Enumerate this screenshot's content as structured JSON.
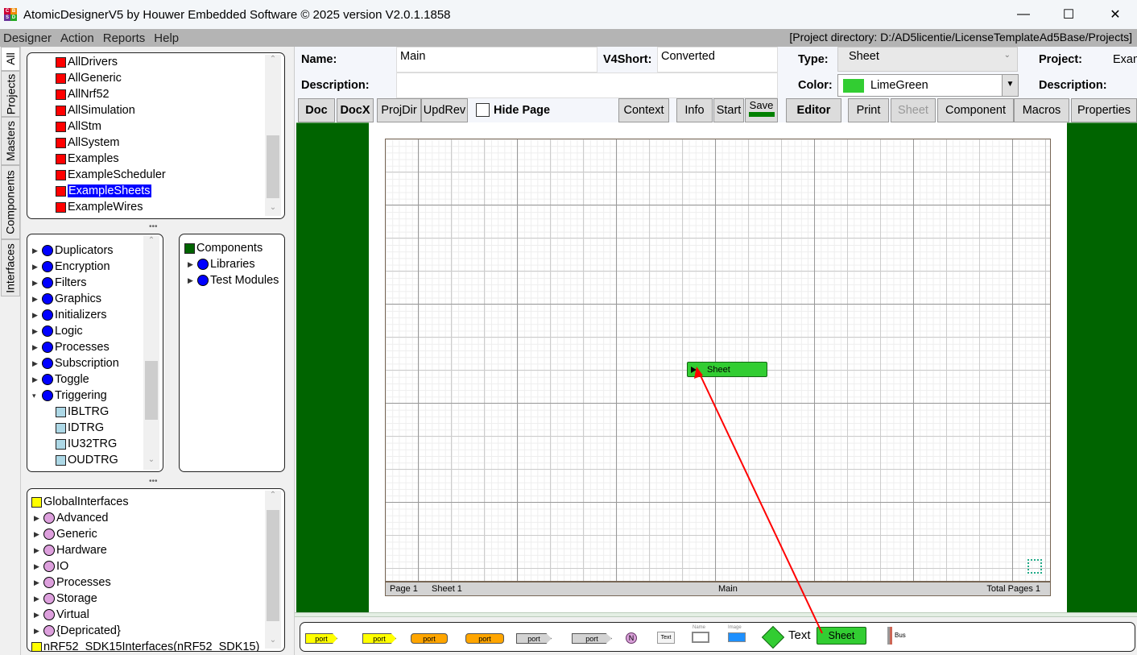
{
  "window": {
    "title": "AtomicDesignerV5 by Houwer Embedded Software © 2025 version V2.0.1.1858",
    "icon_letters": [
      "C",
      "B",
      "S",
      "D"
    ]
  },
  "menu": {
    "items": [
      "Designer",
      "Action",
      "Reports",
      "Help"
    ],
    "project_directory": "[Project directory: D:/AD5licentie/LicenseTemplateAd5Base/Projects]"
  },
  "side_tabs": [
    "All",
    "Projects",
    "Masters",
    "Components",
    "Interfaces"
  ],
  "projects_tree": {
    "items": [
      "AllDrivers",
      "AllGeneric",
      "AllNrf52",
      "AllSimulation",
      "AllStm",
      "AllSystem",
      "Examples",
      "ExampleScheduler",
      "ExampleSheets",
      "ExampleWires"
    ],
    "selected": "ExampleSheets",
    "color": "#ff0000"
  },
  "masters_tree": {
    "groups": [
      "Duplicators",
      "Encryption",
      "Filters",
      "Graphics",
      "Initializers",
      "Logic",
      "Processes",
      "Subscription",
      "Toggle",
      "Triggering"
    ],
    "children": [
      "IBLTRG",
      "IDTRG",
      "IU32TRG",
      "OUDTRG"
    ]
  },
  "components_tree": {
    "root": "Components",
    "groups": [
      "Libraries",
      "Test Modules"
    ]
  },
  "interfaces_tree": {
    "root": "GlobalInterfaces",
    "groups": [
      "Advanced",
      "Generic",
      "Hardware",
      "IO",
      "Processes",
      "Storage",
      "Virtual",
      "{Depricated}"
    ],
    "last": "nRF52_SDK15Interfaces(nRF52_SDK15)"
  },
  "props": {
    "name_label": "Name:",
    "name": "Main",
    "v4short_label": "V4Short:",
    "v4short": "Converted",
    "description_label": "Description:",
    "description": "",
    "type_label": "Type:",
    "type": "Sheet",
    "color_label": "Color:",
    "color": "LimeGreen",
    "color_hex": "#32cd32",
    "project_label": "Project:",
    "project": "Exam",
    "project_desc_label": "Description:"
  },
  "toolbar": {
    "doc": "Doc",
    "docx": "DocX",
    "projdir": "ProjDir",
    "updrev": "UpdRev",
    "hide_page": "Hide Page",
    "hide_page_checked": false,
    "context": "Context",
    "info": "Info",
    "start": "Start",
    "save": "Save",
    "editor": "Editor",
    "print": "Print",
    "sheet": "Sheet",
    "component": "Component",
    "macros": "Macros",
    "properties": "Properties"
  },
  "canvas": {
    "block_label": "Sheet",
    "footer": {
      "page": "Page  1",
      "sheet": "Sheet  1",
      "name": "Main",
      "total": "Total Pages  1"
    }
  },
  "palette": {
    "ports": [
      "port",
      "port",
      "port",
      "port",
      "port",
      "port"
    ],
    "n": "N",
    "text_small": "Text",
    "name_label": "Name",
    "image_label": "Image",
    "text": "Text",
    "sheet": "Sheet",
    "bus": "Bus"
  }
}
